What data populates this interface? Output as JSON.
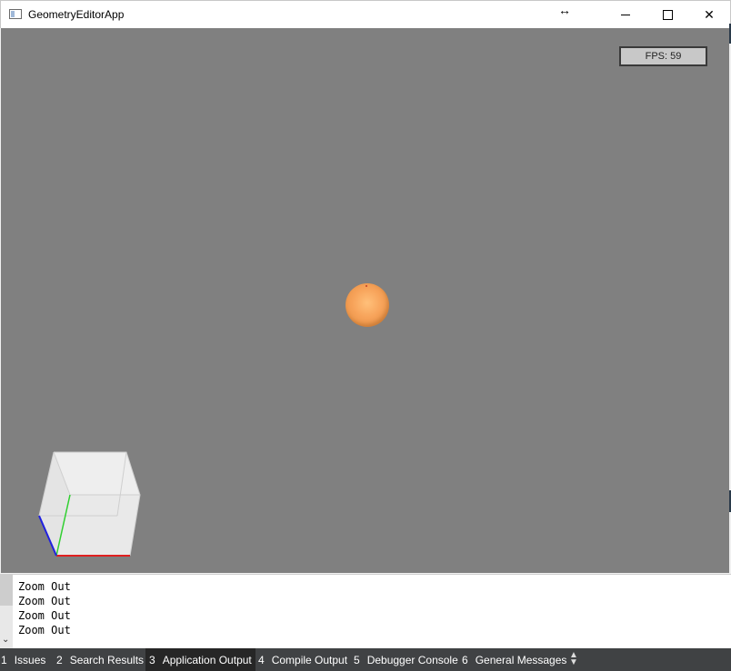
{
  "window": {
    "title": "GeometryEditorApp",
    "resize_cursor_glyph": "↔",
    "minimize_icon": "minimize-icon",
    "maximize_icon": "maximize-icon",
    "close_glyph": "✕"
  },
  "viewport": {
    "fps_label": "FPS: 59",
    "background_color": "#808080",
    "sphere_color": "#f7a35a"
  },
  "output": {
    "lines": [
      "Zoom Out",
      "Zoom Out",
      "Zoom Out",
      "Zoom Out"
    ],
    "scroll_down_glyph": "⌄"
  },
  "tabs": [
    {
      "num": "1",
      "label": "Issues",
      "active": false
    },
    {
      "num": "2",
      "label": "Search Results",
      "active": false
    },
    {
      "num": "3",
      "label": "Application Output",
      "active": true
    },
    {
      "num": "4",
      "label": "Compile Output",
      "active": false
    },
    {
      "num": "5",
      "label": "Debugger Console",
      "active": false
    },
    {
      "num": "6",
      "label": "General Messages",
      "active": false
    }
  ],
  "tab_menu_glyphs": {
    "up": "▲",
    "down": "▼"
  }
}
